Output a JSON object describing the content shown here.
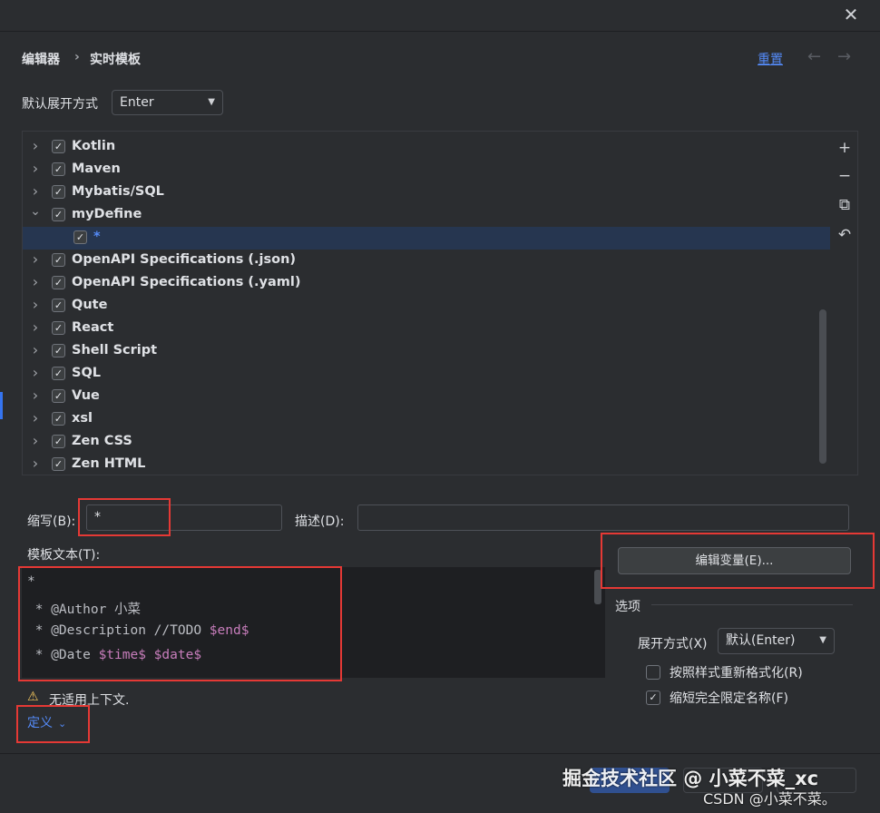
{
  "breadcrumb": {
    "parent": "编辑器",
    "separator": "›",
    "current": "实时模板"
  },
  "header": {
    "reset_label": "重置",
    "back_icon": "←",
    "forward_icon": "→"
  },
  "default_expand": {
    "label": "默认展开方式",
    "value": "Enter"
  },
  "tree": {
    "rows": [
      {
        "label": "Kotlin",
        "checked": true,
        "expanded": false
      },
      {
        "label": "Maven",
        "checked": true,
        "expanded": false
      },
      {
        "label": "Mybatis/SQL",
        "checked": true,
        "expanded": false
      },
      {
        "label": "myDefine",
        "checked": true,
        "expanded": true
      },
      {
        "label": "*",
        "checked": true,
        "child": true,
        "selected": true
      },
      {
        "label": "OpenAPI Specifications (.json)",
        "checked": true,
        "expanded": false
      },
      {
        "label": "OpenAPI Specifications (.yaml)",
        "checked": true,
        "expanded": false
      },
      {
        "label": "Qute",
        "checked": true,
        "expanded": false
      },
      {
        "label": "React",
        "checked": true,
        "expanded": false
      },
      {
        "label": "Shell Script",
        "checked": true,
        "expanded": false
      },
      {
        "label": "SQL",
        "checked": true,
        "expanded": false
      },
      {
        "label": "Vue",
        "checked": true,
        "expanded": false
      },
      {
        "label": "xsl",
        "checked": true,
        "expanded": false
      },
      {
        "label": "Zen CSS",
        "checked": true,
        "expanded": false
      },
      {
        "label": "Zen HTML",
        "checked": true,
        "expanded": false
      }
    ]
  },
  "toolbar": {
    "add_icon": "plus-icon",
    "remove_icon": "minus-icon",
    "copy_icon": "copy-icon",
    "restore_icon": "undo-icon"
  },
  "abbreviation": {
    "label": "缩写(B):",
    "value": "*"
  },
  "description": {
    "label": "描述(D):",
    "value": ""
  },
  "template_text": {
    "label": "模板文本(T):",
    "lines": [
      {
        "plain": "*",
        "var": ""
      },
      {
        "plain": " * @Author 小菜",
        "var": ""
      },
      {
        "plain": " * @Description //TODO ",
        "var": "$end$"
      },
      {
        "plain": " * @Date ",
        "var": "$time$ $date$"
      }
    ]
  },
  "edit_variables_label": "编辑变量(E)...",
  "options": {
    "title": "选项",
    "expand_label": "展开方式(X)",
    "expand_value": "默认(Enter)",
    "reformat_label": "按照样式重新格式化(R)",
    "reformat_checked": false,
    "shorten_label": "缩短完全限定名称(F)",
    "shorten_checked": true
  },
  "warning_text": "无适用上下文.",
  "define_link": "定义",
  "watermark": {
    "line1": "掘金技术社区 @ 小菜不菜_xc",
    "line2": "CSDN @小菜不菜。"
  },
  "colors": {
    "accent": "#548af7",
    "highlight_border": "#e53935",
    "selected_row": "#263650",
    "variable": "#c77dbb"
  }
}
